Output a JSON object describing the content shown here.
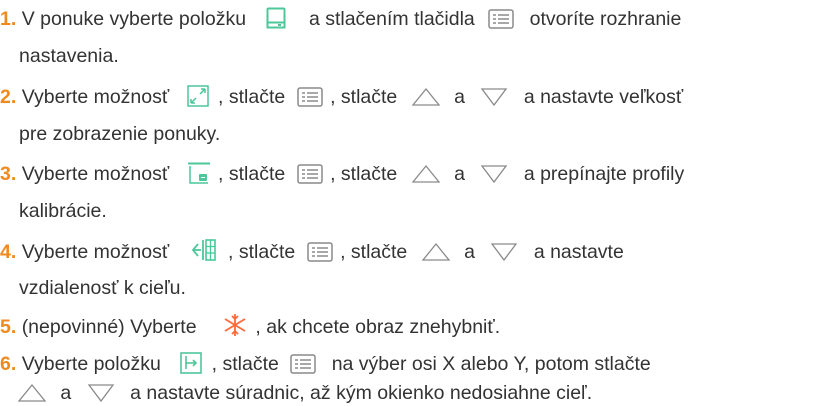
{
  "steps": [
    {
      "number": "1.",
      "parts": [
        "V ponuke vyberte položku",
        "a stlačením tlačidla",
        "otvoríte rozhranie"
      ],
      "continuation": "nastavenia."
    },
    {
      "number": "2.",
      "parts": [
        "Vyberte možnosť",
        ", stlačte",
        ", stlačte",
        "a",
        "a nastavte veľkosť"
      ],
      "continuation": "pre zobrazenie ponuky."
    },
    {
      "number": "3.",
      "parts": [
        "Vyberte možnosť",
        ", stlačte",
        ", stlačte",
        "a",
        "a prepínajte profily"
      ],
      "continuation": "kalibrácie."
    },
    {
      "number": "4.",
      "parts": [
        "Vyberte možnosť",
        ", stlačte",
        ", stlačte",
        "a",
        "a nastavte"
      ],
      "continuation": "vzdialenosť k cieľu."
    },
    {
      "number": "5.",
      "parts": [
        "(nepovinné) Vyberte",
        ", ak chcete obraz znehybniť."
      ]
    },
    {
      "number": "6.",
      "parts": [
        "Vyberte položku",
        ", stlačte",
        "na výber osi X alebo Y, potom stlačte"
      ],
      "continuation": [
        "a",
        "a nastavte súradnic, až kým okienko nedosiahne cieľ."
      ]
    }
  ],
  "icons": {
    "display": "display-icon",
    "menu": "menu-button-icon",
    "up": "up-triangle-icon",
    "down": "down-triangle-icon",
    "resize": "resize-icon",
    "calibration_profile": "calibration-profile-icon",
    "distance": "target-distance-icon",
    "freeze": "freeze-snowflake-icon",
    "coordinate": "coordinate-icon"
  },
  "colors": {
    "step_number": "#f08a1c",
    "icon_accent": "#4cc79a",
    "freeze_icon": "#ff6a3d",
    "text": "#333333",
    "icon_gray": "#8a8a8a"
  }
}
